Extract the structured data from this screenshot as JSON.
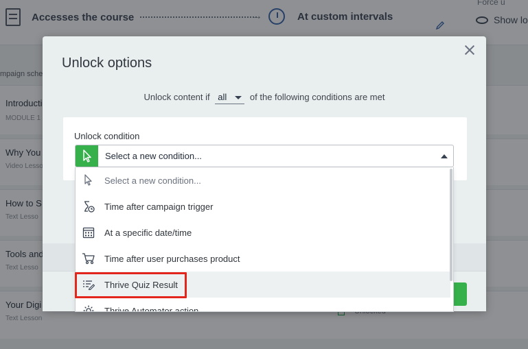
{
  "background": {
    "trigger_label": "Accesses the course",
    "interval_label": "At custom intervals",
    "right_top_text": "Force u",
    "show_label": "Show lo",
    "campaign_label": "mpaign sche",
    "rows": [
      {
        "title": "Introductio",
        "subtitle": "MODULE 1"
      },
      {
        "title": "Why You",
        "subtitle": "Video Lesso"
      },
      {
        "title": "How to S",
        "subtitle": "Text Lesso"
      },
      {
        "title": "Tools and",
        "subtitle": "Text Lesso"
      },
      {
        "title": "Your Digi",
        "subtitle": "Text Lesson"
      }
    ],
    "unlocked_label": "Unlocked"
  },
  "modal": {
    "title": "Unlock options",
    "rule_prefix": "Unlock content if",
    "rule_mode": "all",
    "rule_suffix": "of the following conditions are met",
    "condition_label": "Unlock condition",
    "select_value": "Select a new condition...",
    "dropdown_items": [
      {
        "label": "Select a new condition...",
        "icon": "cursor-icon"
      },
      {
        "label": "Time after campaign trigger",
        "icon": "hourglass-clock-icon"
      },
      {
        "label": "At a specific date/time",
        "icon": "calendar-icon"
      },
      {
        "label": "Time after user purchases product",
        "icon": "cart-icon"
      },
      {
        "label": "Thrive Quiz Result",
        "icon": "quiz-list-icon"
      },
      {
        "label": "Thrive Automator action",
        "icon": "gear-icon"
      }
    ]
  },
  "colors": {
    "accent_green": "#35b04a",
    "highlight_red": "#e3261d"
  }
}
